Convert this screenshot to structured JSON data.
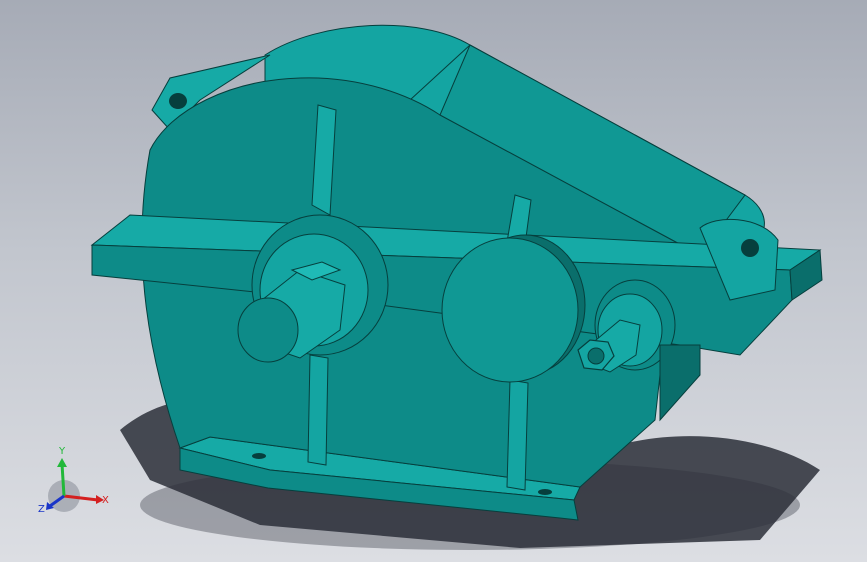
{
  "viewport": {
    "background_top": "#a6abb6",
    "background_bottom": "#dcdee3"
  },
  "model": {
    "description_icon": "gear-reducer-housing-icon",
    "colors": {
      "housing_light": "#14a5a2",
      "housing_mid": "#0d8b88",
      "housing_dark": "#0a6e6b",
      "edge": "#063f3d",
      "shadow": "#2b2f38"
    }
  },
  "triad": {
    "x_label": "X",
    "y_label": "Y",
    "z_label": "Z",
    "x_color": "#d42020",
    "y_color": "#22b83a",
    "z_color": "#1a35c8"
  }
}
